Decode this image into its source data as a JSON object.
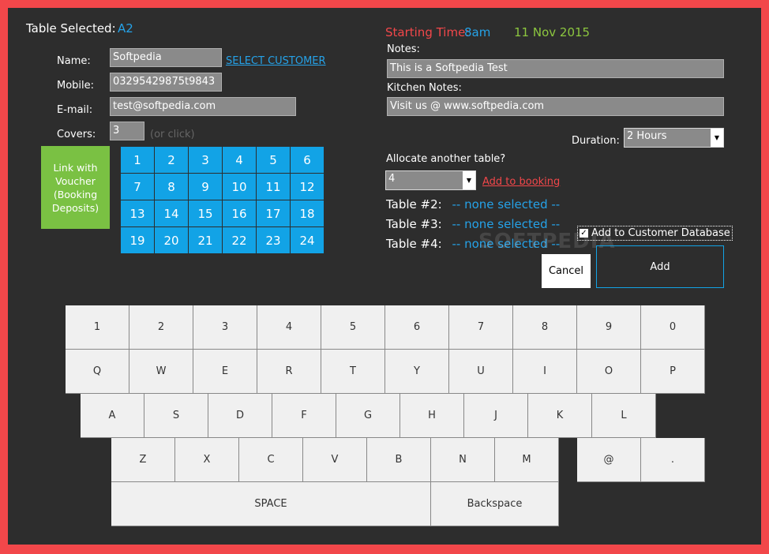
{
  "header": {
    "table_selected_label": "Table Selected:",
    "table_selected_value": "A2",
    "starting_time_label": "Starting Time:",
    "starting_time_value": "8am",
    "date_value": "11 Nov 2015"
  },
  "customer": {
    "name_label": "Name:",
    "name_value": "Softpedia",
    "select_customer_link": "SELECT CUSTOMER",
    "mobile_label": "Mobile:",
    "mobile_value": "03295429875t9843",
    "email_label": "E-mail:",
    "email_value": "test@softpedia.com",
    "covers_label": "Covers:",
    "covers_value": "3",
    "covers_hint": "(or click)"
  },
  "voucher_button": "Link with Voucher (Booking Deposits)",
  "covers_grid": [
    "1",
    "2",
    "3",
    "4",
    "5",
    "6",
    "7",
    "8",
    "9",
    "10",
    "11",
    "12",
    "13",
    "14",
    "15",
    "16",
    "17",
    "18",
    "19",
    "20",
    "21",
    "22",
    "23",
    "24"
  ],
  "notes": {
    "notes_label": "Notes:",
    "notes_value": "This is a Softpedia Test",
    "kitchen_label": "Kitchen Notes:",
    "kitchen_value": "Visit us @ www.softpedia.com"
  },
  "duration": {
    "label": "Duration:",
    "value": "2 Hours"
  },
  "allocate": {
    "label": "Allocate another table?",
    "value": "4",
    "add_link": "Add to booking",
    "tables": [
      {
        "label": "Table #2:",
        "value": "-- none selected --"
      },
      {
        "label": "Table #3:",
        "value": "-- none selected --"
      },
      {
        "label": "Table #4:",
        "value": "-- none selected --"
      }
    ]
  },
  "add_to_db_label": "Add to Customer Database",
  "cancel_button": "Cancel",
  "add_button": "Add",
  "watermark": "SOFTPEDIA",
  "keyboard": {
    "row1": [
      "1",
      "2",
      "3",
      "4",
      "5",
      "6",
      "7",
      "8",
      "9",
      "0"
    ],
    "row2": [
      "Q",
      "W",
      "E",
      "R",
      "T",
      "Y",
      "U",
      "I",
      "O",
      "P"
    ],
    "row3": [
      "A",
      "S",
      "D",
      "F",
      "G",
      "H",
      "J",
      "K",
      "L"
    ],
    "row4": [
      "Z",
      "X",
      "C",
      "V",
      "B",
      "N",
      "M"
    ],
    "row4_extra": [
      "@",
      "."
    ],
    "space": "SPACE",
    "backspace": "Backspace"
  },
  "colors": {
    "frame": "#f2474a",
    "panel": "#2d2d2d",
    "accent_blue": "#12a3e6",
    "voucher_green": "#7ac143",
    "date_green": "#8cc63f"
  }
}
